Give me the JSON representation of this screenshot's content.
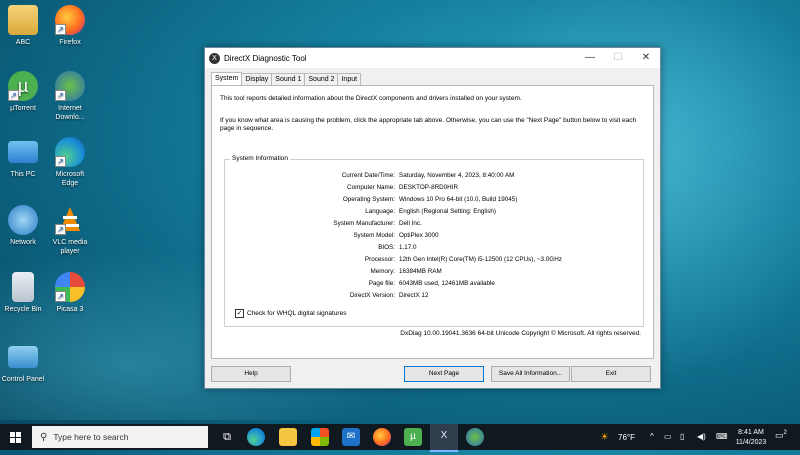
{
  "desktop": {
    "icons": [
      {
        "label": "ABC"
      },
      {
        "label": "Firefox"
      },
      {
        "label": "µTorrent"
      },
      {
        "label": "Internet Downlo..."
      },
      {
        "label": "This PC"
      },
      {
        "label": "Microsoft Edge"
      },
      {
        "label": "Network"
      },
      {
        "label": "VLC media player"
      },
      {
        "label": "Recycle Bin"
      },
      {
        "label": "Picasa 3"
      },
      {
        "label": "Control Panel"
      }
    ]
  },
  "window": {
    "title": "DirectX Diagnostic Tool",
    "controls": {
      "minimize": "—",
      "maximize": "☐",
      "close": "✕"
    },
    "tabs": [
      "System",
      "Display",
      "Sound 1",
      "Sound 2",
      "Input"
    ],
    "intro1": "This tool reports detailed information about the DirectX components and drivers installed on your system.",
    "intro2": "If you know what area is causing the problem, click the appropriate tab above.  Otherwise, you can use the \"Next Page\" button below to visit each page in sequence.",
    "group_title": "System Information",
    "info": [
      {
        "k": "Current Date/Time:",
        "v": "Saturday, November 4, 2023, 8:40:00 AM"
      },
      {
        "k": "Computer Name:",
        "v": "DESKTOP-8RD0HIR"
      },
      {
        "k": "Operating System:",
        "v": "Windows 10 Pro 64-bit (10.0, Build 19045)"
      },
      {
        "k": "Language:",
        "v": "English (Regional Setting: English)"
      },
      {
        "k": "System Manufacturer:",
        "v": "Dell Inc."
      },
      {
        "k": "System Model:",
        "v": "OptiPlex 3000"
      },
      {
        "k": "BIOS:",
        "v": "1.17.0"
      },
      {
        "k": "Processor:",
        "v": "12th Gen Intel(R) Core(TM) i5-12500 (12 CPUs), ~3.0GHz"
      },
      {
        "k": "Memory:",
        "v": "16384MB RAM"
      },
      {
        "k": "Page file:",
        "v": "6043MB used, 12461MB available"
      },
      {
        "k": "DirectX Version:",
        "v": "DirectX 12"
      }
    ],
    "checkbox": {
      "label": "Check for WHQL digital signatures",
      "checked": true
    },
    "footer": "DxDiag 10.00.19041.3636 64-bit Unicode  Copyright © Microsoft. All rights reserved.",
    "buttons": {
      "help": "Help",
      "next": "Next Page",
      "save": "Save All Information...",
      "exit": "Exit"
    }
  },
  "taskbar": {
    "search_placeholder": "Type here to search",
    "weather": "76°F",
    "time": "8:41 AM",
    "date": "11/4/2023",
    "notifications": "2"
  }
}
